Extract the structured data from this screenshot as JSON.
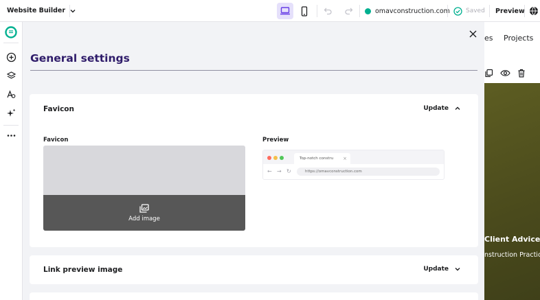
{
  "topbar": {
    "app_title": "Website Builder",
    "domain": "omavconstruction.com",
    "saved_label": "Saved",
    "preview_label": "Preview"
  },
  "site": {
    "nav_partial": "es",
    "nav_projects": "Projects",
    "hero_title": "Client Advice",
    "hero_subtitle": "nstruction Practic"
  },
  "panel": {
    "title": "General settings",
    "favicon_section": {
      "title": "Favicon",
      "action": "Update",
      "field_label": "Favicon",
      "add_image_label": "Add image",
      "preview_label": "Preview",
      "browser_tab_title": "Top-notch constru",
      "browser_url": "https://omavconstruction.com"
    },
    "link_preview_section": {
      "title": "Link preview image",
      "action": "Update"
    }
  },
  "colors": {
    "accent": "#673de6",
    "accent_bg": "#e5e0fb",
    "domain_dot": "#00b090",
    "panel_bg": "#f2f3f6",
    "title": "#2f1c6a",
    "uploader_dark": "#575757"
  }
}
